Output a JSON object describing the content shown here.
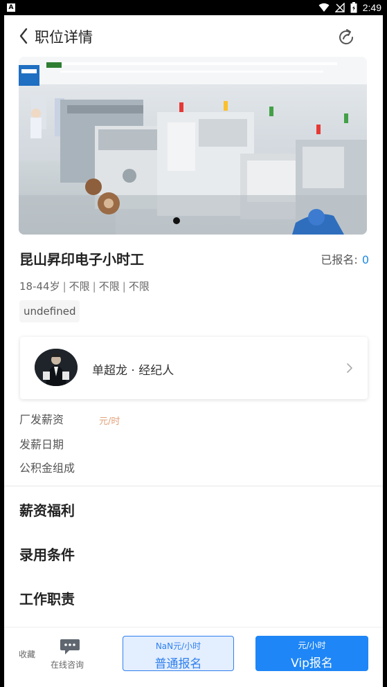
{
  "status_bar": {
    "app_badge": "A",
    "time": "2:49"
  },
  "header": {
    "title": "职位详情"
  },
  "job": {
    "title": "昆山昇印电子小时工",
    "signup_label": "已报名:",
    "signup_count": "0",
    "requirements": [
      "18-44岁",
      "不限",
      "不限",
      "不限"
    ],
    "requirement_separator": "|",
    "chip": "undefined"
  },
  "agent": {
    "name": "单超龙 · 经纪人"
  },
  "details": {
    "salary_label": "厂发薪资",
    "salary_unit": "元/时",
    "payday_label": "发薪日期",
    "fund_label": "公积金组成"
  },
  "sections": {
    "benefits": "薪资福利",
    "conditions": "录用条件",
    "duties": "工作职责"
  },
  "bottom_bar": {
    "collect_label": "收藏",
    "consult_label": "在线咨询",
    "normal_price": "NaN元/小时",
    "normal_label": "普通报名",
    "vip_price": "元/小时",
    "vip_label": "Vip报名"
  },
  "colors": {
    "accent": "#1e86f6",
    "count": "#1e88e5",
    "salary_unit": "#e2a27a"
  }
}
